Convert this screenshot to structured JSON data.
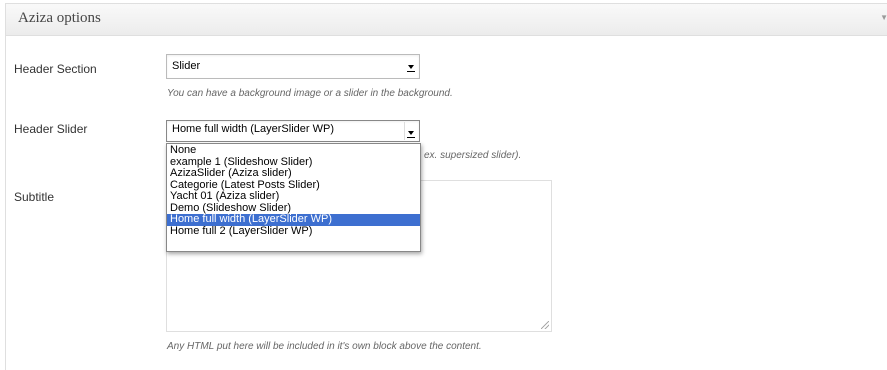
{
  "panel": {
    "title": "Aziza options"
  },
  "fields": {
    "header_section": {
      "label": "Header Section",
      "value": "Slider",
      "hint": "You can have a background image or a slider in the background."
    },
    "header_slider": {
      "label": "Header Slider",
      "value": "Home full width (LayerSlider WP)",
      "hint_tail": "ex. supersized slider).",
      "options": [
        "None",
        "example 1 (Slideshow Slider)",
        "AzizaSlider (Aziza slider)",
        "Categorie (Latest Posts Slider)",
        "Yacht 01 (Aziza slider)",
        "Demo (Slideshow Slider)",
        "Home full width (LayerSlider WP)",
        "Home full 2 (LayerSlider WP)"
      ],
      "selected_index": 6
    },
    "subtitle": {
      "label": "Subtitle",
      "value": "",
      "hint": "Any HTML put here will be included in it's own block above the content."
    }
  },
  "colors": {
    "selection": "#3d6fd0"
  }
}
